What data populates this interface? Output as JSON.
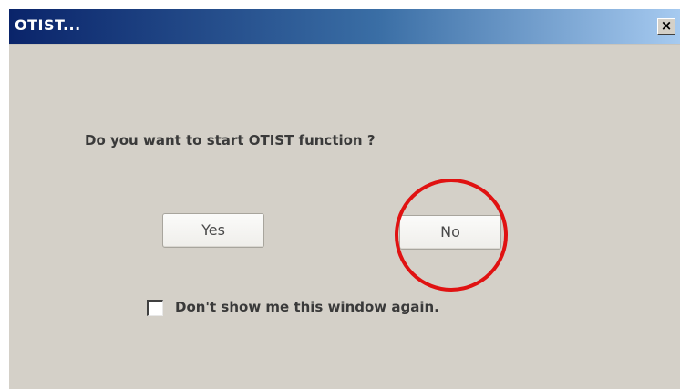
{
  "window": {
    "title": "OTIST...",
    "close_symbol": "×"
  },
  "dialog": {
    "prompt": "Do you want to start OTIST function ?",
    "yes_label": "Yes",
    "no_label": "No",
    "checkbox_label": "Don't show me this window again.",
    "checkbox_checked": false
  },
  "annotation": {
    "highlight": "circle around No button",
    "color": "#e01212"
  },
  "colors": {
    "dialog_bg": "#d4d0c8",
    "title_start": "#0a246a",
    "title_end": "#a6caf0"
  },
  "icons": [
    "close-icon",
    "checkbox-icon"
  ]
}
